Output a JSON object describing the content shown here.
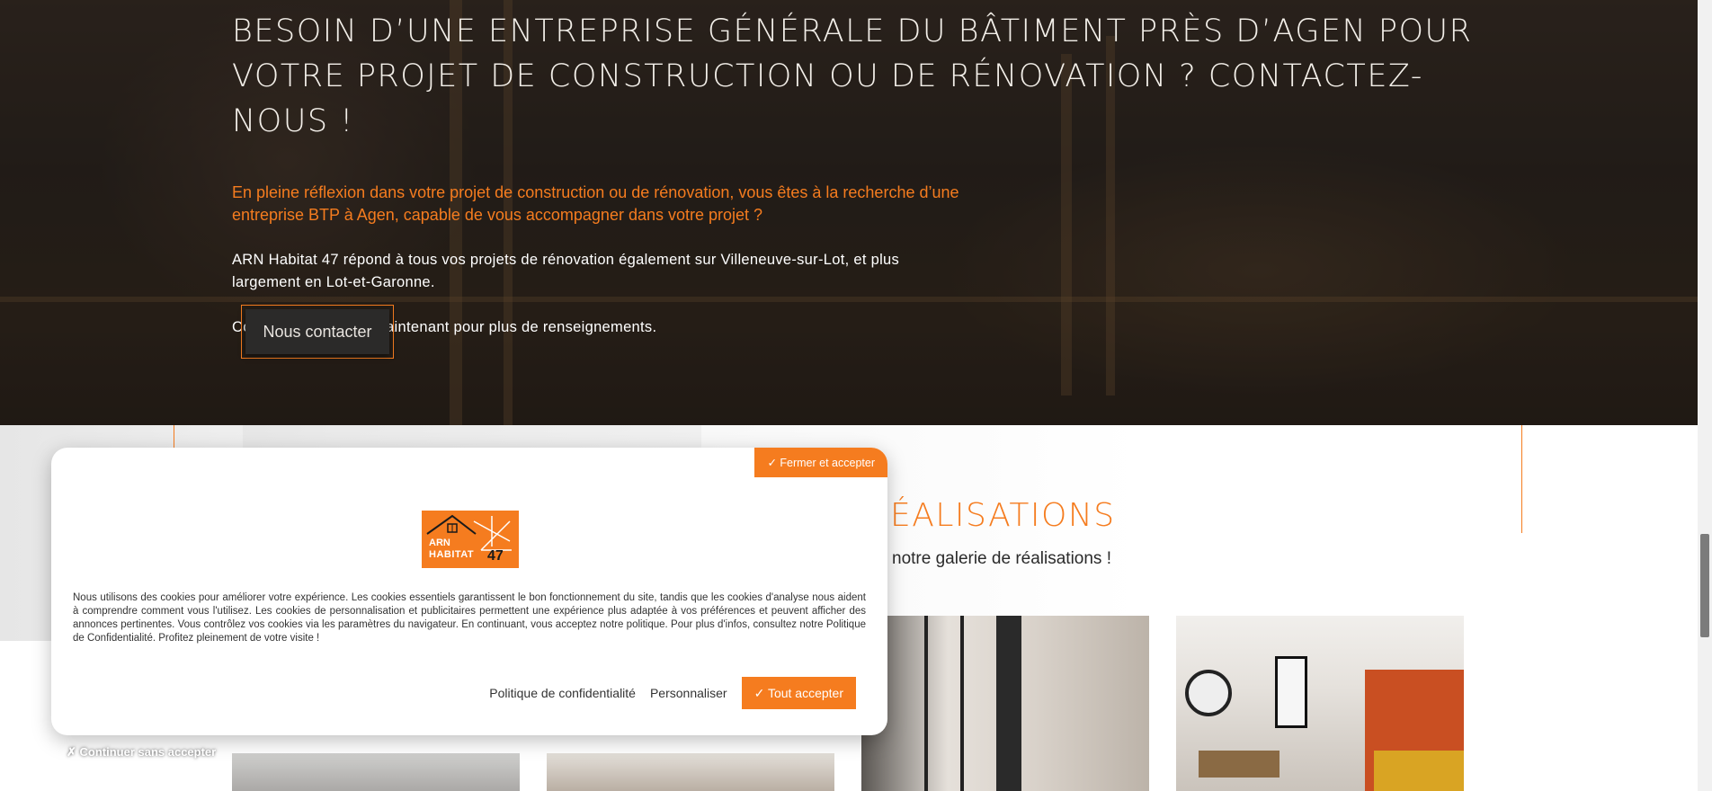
{
  "hero": {
    "title": "Besoin d’une entreprise générale du bâtiment près d’Agen pour votre projet de construction ou de rénovation ? Contactez-nous !",
    "lead": "En pleine réflexion dans votre projet de construction ou de rénovation, vous êtes à la recherche d’une entreprise BTP à Agen, capable de vous accompagner dans votre projet ?",
    "paragraph_1": "ARN Habitat 47 répond à tous vos projets de rénovation également sur Villeneuve-sur-Lot, et plus largement en Lot-et-Garonne.",
    "paragraph_2": "Contactez-nous dès maintenant pour plus de renseignements.",
    "contact_button": "Nous contacter"
  },
  "realisations": {
    "title_visible": "ÉALISATIONS",
    "subtitle_visible": "notre galerie de réalisations !"
  },
  "cookie_banner": {
    "close_accept_button": "✓ Fermer et accepter",
    "logo": {
      "line1": "ARN",
      "line2": "HABITAT",
      "number": "47"
    },
    "text": "Nous utilisons des cookies pour améliorer votre expérience. Les cookies essentiels garantissent le bon fonctionnement du site, tandis que les cookies d'analyse nous aident à comprendre comment vous l'utilisez. Les cookies de personnalisation et publicitaires permettent une expérience plus adaptée à vos préférences et peuvent afficher des annonces pertinentes. Vous contrôlez vos cookies via les paramètres du navigateur. En continuant, vous acceptez notre politique. Pour plus d'infos, consultez notre Politique de Confidentialité. Profitez pleinement de votre visite !",
    "privacy_link": "Politique de confidentialité",
    "customize_link": "Personnaliser",
    "accept_all_button": "✓ Tout accepter",
    "continue_without_accepting": "✗ Continuer sans accepter"
  },
  "colors": {
    "accent": "#f57c1f",
    "hero_dark": "#2d2622",
    "button_dark": "#2b2a29"
  }
}
